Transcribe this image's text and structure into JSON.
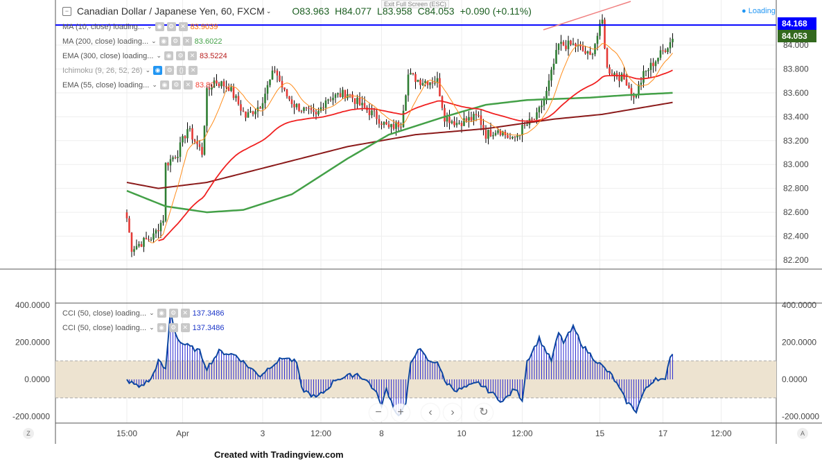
{
  "header": {
    "symbol": "Canadian Dollar / Japanese Yen, 60, FXCM",
    "open": "O83.963",
    "high": "H84.077",
    "low": "L83.958",
    "close": "C84.053",
    "change": "+0.090 (+0.11%)",
    "tooltip": "Exit Full Screen (ESC)",
    "status": "Loading"
  },
  "indicators": [
    {
      "label": "MA (10, close) loading...",
      "value": "83.9039",
      "color": "#ff6d00"
    },
    {
      "label": "MA (200, close) loading...",
      "value": "83.6022",
      "color": "#43a047"
    },
    {
      "label": "EMA (300, close) loading...",
      "value": "83.5224",
      "color": "#b71c1c"
    },
    {
      "label": "Ichimoku (9, 26, 52, 26)",
      "value": "",
      "color": "#999"
    },
    {
      "label": "EMA (55, close) loading...",
      "value": "83.80",
      "color": "#f44336"
    }
  ],
  "cci_legend": [
    {
      "label": "CCI (50, close) loading...",
      "value": "137.3486"
    },
    {
      "label": "CCI (50, close) loading...",
      "value": "137.3486"
    }
  ],
  "price_labels": {
    "line": "84.168",
    "last": "84.053"
  },
  "controls": {
    "zoom_out": "−",
    "zoom_in": "+",
    "scroll_left": "‹",
    "scroll_right": "›",
    "reset": "↻"
  },
  "footer": "Created with Tradingview.com",
  "corners": {
    "left": "Z",
    "right": "A"
  },
  "chart_data": {
    "type": "candlestick",
    "price_axis": [
      "84.000",
      "83.800",
      "83.600",
      "83.400",
      "83.200",
      "83.000",
      "82.800",
      "82.600",
      "82.400",
      "82.200"
    ],
    "cci_axis": [
      "400.0000",
      "200.0000",
      "0.0000",
      "-200.0000"
    ],
    "time_axis": [
      {
        "label": "15:00",
        "bar": 0
      },
      {
        "label": "Apr",
        "bar": 23
      },
      {
        "label": "3",
        "bar": 56
      },
      {
        "label": "12:00",
        "bar": 80
      },
      {
        "label": "8",
        "bar": 105
      },
      {
        "label": "10",
        "bar": 138
      },
      {
        "label": "12:00",
        "bar": 163
      },
      {
        "label": "15",
        "bar": 195
      },
      {
        "label": "17",
        "bar": 221
      },
      {
        "label": "12:00",
        "bar": 245
      }
    ],
    "close_keypoints": [
      [
        0,
        82.55
      ],
      [
        2,
        82.3
      ],
      [
        11,
        82.4
      ],
      [
        15,
        82.55
      ],
      [
        16,
        83.0
      ],
      [
        21,
        83.1
      ],
      [
        25,
        83.3
      ],
      [
        31,
        83.1
      ],
      [
        33,
        83.6
      ],
      [
        36,
        83.7
      ],
      [
        42,
        83.65
      ],
      [
        49,
        83.4
      ],
      [
        55,
        83.5
      ],
      [
        61,
        83.8
      ],
      [
        65,
        83.6
      ],
      [
        69,
        83.5
      ],
      [
        78,
        83.4
      ],
      [
        82,
        83.55
      ],
      [
        91,
        83.6
      ],
      [
        96,
        83.5
      ],
      [
        103,
        83.4
      ],
      [
        108,
        83.3
      ],
      [
        113,
        83.35
      ],
      [
        116,
        83.75
      ],
      [
        121,
        83.7
      ],
      [
        128,
        83.7
      ],
      [
        131,
        83.4
      ],
      [
        136,
        83.35
      ],
      [
        145,
        83.4
      ],
      [
        148,
        83.25
      ],
      [
        153,
        83.3
      ],
      [
        159,
        83.2
      ],
      [
        163,
        83.3
      ],
      [
        169,
        83.4
      ],
      [
        173,
        83.6
      ],
      [
        178,
        84.0
      ],
      [
        185,
        84.0
      ],
      [
        191,
        83.9
      ],
      [
        196,
        84.2
      ],
      [
        198,
        83.8
      ],
      [
        202,
        83.75
      ],
      [
        206,
        83.7
      ],
      [
        209,
        83.55
      ],
      [
        213,
        83.75
      ],
      [
        219,
        83.9
      ],
      [
        225,
        84.05
      ]
    ],
    "ma200": [
      [
        0,
        82.78
      ],
      [
        16,
        82.65
      ],
      [
        33,
        82.6
      ],
      [
        48,
        82.62
      ],
      [
        68,
        82.75
      ],
      [
        91,
        83.05
      ],
      [
        108,
        83.25
      ],
      [
        131,
        83.4
      ],
      [
        148,
        83.5
      ],
      [
        165,
        83.54
      ],
      [
        191,
        83.56
      ],
      [
        205,
        83.58
      ],
      [
        225,
        83.6
      ]
    ],
    "ema300": [
      [
        0,
        82.85
      ],
      [
        13,
        82.8
      ],
      [
        33,
        82.85
      ],
      [
        62,
        83.0
      ],
      [
        91,
        83.15
      ],
      [
        119,
        83.25
      ],
      [
        148,
        83.3
      ],
      [
        176,
        83.38
      ],
      [
        196,
        83.42
      ],
      [
        225,
        83.52
      ]
    ],
    "cci": [
      [
        0,
        -5
      ],
      [
        5,
        -40
      ],
      [
        10,
        0
      ],
      [
        13,
        100
      ],
      [
        16,
        50
      ],
      [
        18,
        370
      ],
      [
        20,
        250
      ],
      [
        22,
        200
      ],
      [
        30,
        150
      ],
      [
        33,
        60
      ],
      [
        38,
        150
      ],
      [
        45,
        130
      ],
      [
        50,
        70
      ],
      [
        55,
        20
      ],
      [
        60,
        80
      ],
      [
        65,
        120
      ],
      [
        70,
        90
      ],
      [
        72,
        -50
      ],
      [
        78,
        -100
      ],
      [
        82,
        -60
      ],
      [
        86,
        0
      ],
      [
        95,
        30
      ],
      [
        100,
        -20
      ],
      [
        104,
        -100
      ],
      [
        105,
        -150
      ],
      [
        107,
        -50
      ],
      [
        110,
        -150
      ],
      [
        112,
        -200
      ],
      [
        115,
        -130
      ],
      [
        117,
        80
      ],
      [
        120,
        170
      ],
      [
        125,
        90
      ],
      [
        128,
        100
      ],
      [
        131,
        -10
      ],
      [
        136,
        -60
      ],
      [
        145,
        -20
      ],
      [
        150,
        -70
      ],
      [
        155,
        -120
      ],
      [
        160,
        -50
      ],
      [
        163,
        -110
      ],
      [
        165,
        100
      ],
      [
        170,
        220
      ],
      [
        175,
        100
      ],
      [
        178,
        250
      ],
      [
        180,
        200
      ],
      [
        184,
        280
      ],
      [
        188,
        180
      ],
      [
        192,
        120
      ],
      [
        196,
        70
      ],
      [
        200,
        20
      ],
      [
        203,
        -50
      ],
      [
        206,
        -120
      ],
      [
        210,
        -170
      ],
      [
        213,
        -70
      ],
      [
        218,
        10
      ],
      [
        222,
        -10
      ],
      [
        224,
        130
      ],
      [
        225,
        137
      ]
    ],
    "cci_band": [
      -100,
      100
    ],
    "horizontal_line": 84.168,
    "trend_line": [
      [
        171,
        83.88
      ],
      [
        207,
        84.12
      ]
    ]
  }
}
